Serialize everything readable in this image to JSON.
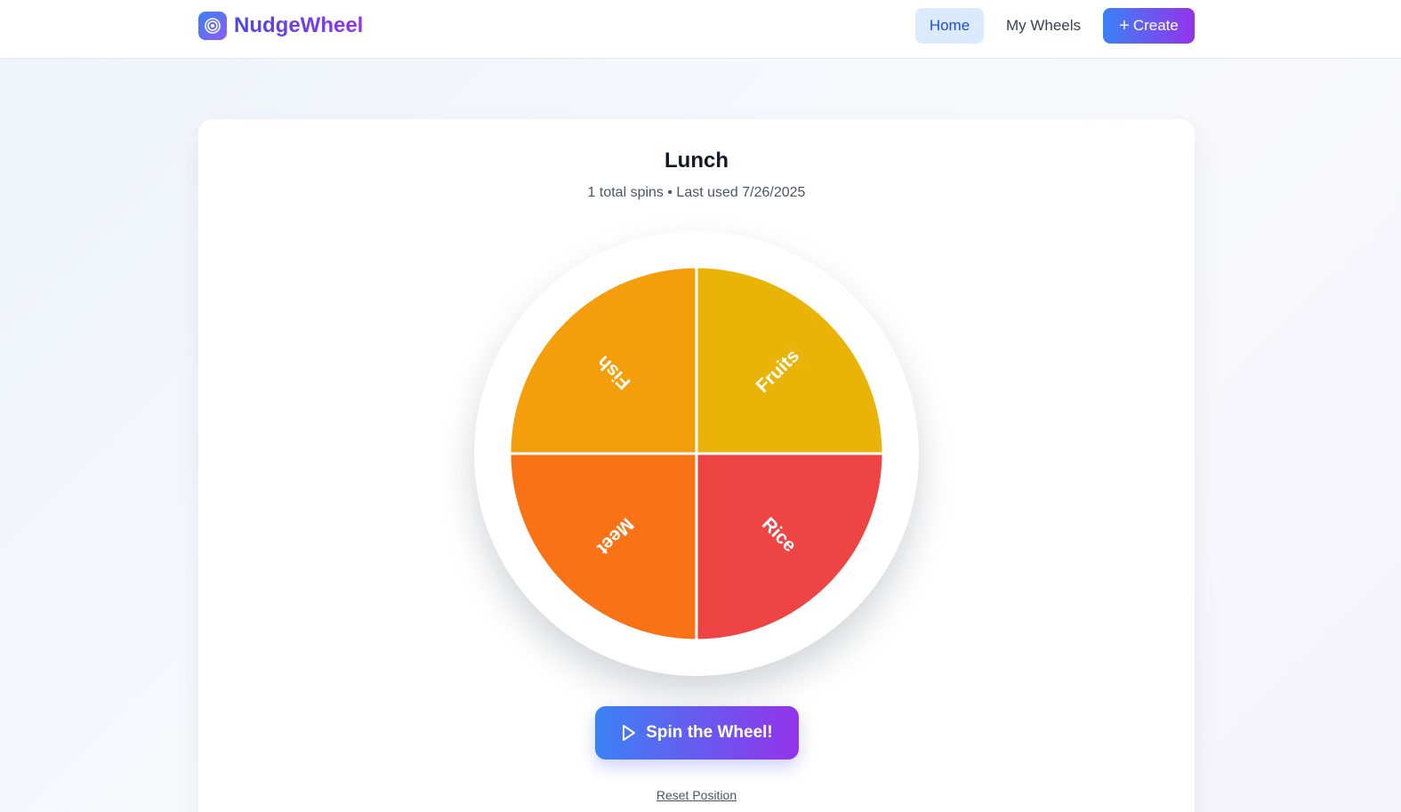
{
  "brand": {
    "name": "NudgeWheel",
    "icon": "target-icon"
  },
  "nav": {
    "home": "Home",
    "my_wheels": "My Wheels",
    "create": "Create",
    "create_icon": "plus-icon"
  },
  "wheel": {
    "title": "Lunch",
    "meta": "1 total spins • Last used 7/26/2025",
    "segments": [
      {
        "label": "Fruits",
        "color": "#eab308"
      },
      {
        "label": "Rice",
        "color": "#ef4444"
      },
      {
        "label": "Meet",
        "color": "#f97316"
      },
      {
        "label": "Fish",
        "color": "#f59e0b"
      }
    ]
  },
  "actions": {
    "spin": "Spin the Wheel!",
    "spin_icon": "play-icon",
    "reset": "Reset Position"
  },
  "colors": {
    "accent_start": "#3b82f6",
    "accent_end": "#9333ea",
    "nav_active_bg": "#dbeafe"
  }
}
